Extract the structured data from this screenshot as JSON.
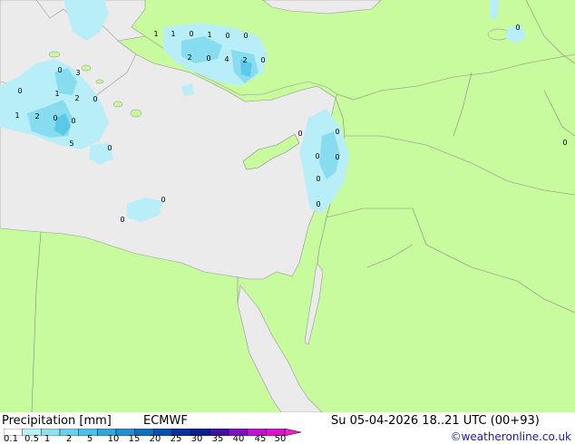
{
  "footer": {
    "title_left": "Precipitation [mm]",
    "model": "ECMWF",
    "datetime": "Su 05-04-2026 18..21 UTC (00+93)",
    "credit": "©weatheronline.co.uk"
  },
  "legend": {
    "ticks": [
      "0.1",
      "0.5",
      "1",
      "2",
      "5",
      "10",
      "15",
      "20",
      "25",
      "30",
      "35",
      "40",
      "45",
      "50"
    ],
    "colors": [
      "#ffffff",
      "#b8f0f8",
      "#90e0f0",
      "#6cd0ec",
      "#48c0e8",
      "#30a8dc",
      "#2090d0",
      "#1070c0",
      "#0850b0",
      "#0830a0",
      "#082090",
      "#4010a8",
      "#8010c0",
      "#c010d0",
      "#e010d0",
      "#f020c8"
    ]
  },
  "map_labels": [
    {
      "text": "1"
    },
    {
      "text": "1"
    },
    {
      "text": "0"
    },
    {
      "text": "1"
    },
    {
      "text": "0"
    },
    {
      "text": "0"
    },
    {
      "text": "2"
    },
    {
      "text": "0"
    },
    {
      "text": "4"
    },
    {
      "text": "2"
    },
    {
      "text": "0"
    },
    {
      "text": "0"
    },
    {
      "text": "3"
    },
    {
      "text": "1"
    },
    {
      "text": "2"
    },
    {
      "text": "0"
    },
    {
      "text": "0"
    },
    {
      "text": "1"
    },
    {
      "text": "2"
    },
    {
      "text": "0"
    },
    {
      "text": "0"
    },
    {
      "text": "5"
    },
    {
      "text": "0"
    },
    {
      "text": "0"
    },
    {
      "text": "0"
    },
    {
      "text": "0"
    },
    {
      "text": "0"
    },
    {
      "text": "0"
    },
    {
      "text": "0"
    },
    {
      "text": "0"
    },
    {
      "text": "0"
    },
    {
      "text": "0"
    }
  ],
  "colors": {
    "land": "#c8fa9e",
    "sea": "#ebebeb",
    "border": "#999999",
    "precip_light": "#b8eef8",
    "precip_mid": "#88dcf0",
    "precip_strong": "#5cc8e8"
  }
}
